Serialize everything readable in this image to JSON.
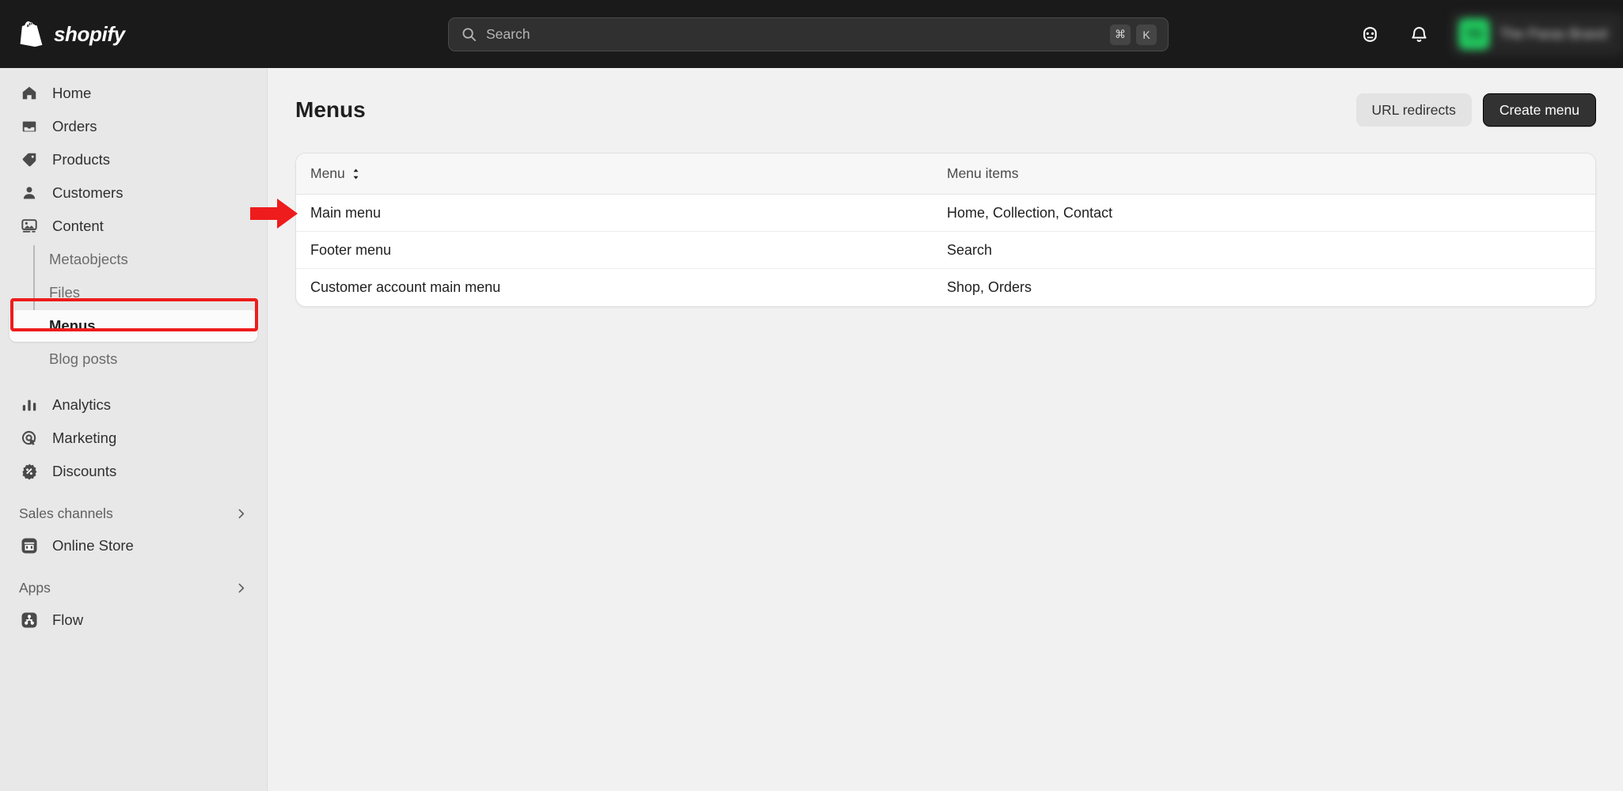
{
  "topbar": {
    "brand": "shopify",
    "logo_icon": "shopify-bag-icon",
    "search": {
      "icon": "search-icon",
      "placeholder": "Search",
      "shortcut_modifier": "⌘",
      "shortcut_key": "K"
    },
    "actions": [
      {
        "icon": "avatar-face-icon",
        "name": "support-avatar-button"
      },
      {
        "icon": "bell-icon",
        "name": "notifications-button"
      }
    ],
    "store": {
      "avatar_initials": "TR",
      "name": "The Paras Brand",
      "avatar_color": "#22c55e"
    }
  },
  "sidebar": {
    "items": [
      {
        "label": "Home",
        "icon": "home-icon"
      },
      {
        "label": "Orders",
        "icon": "orders-inbox-icon"
      },
      {
        "label": "Products",
        "icon": "products-tag-icon"
      },
      {
        "label": "Customers",
        "icon": "customers-person-icon"
      },
      {
        "label": "Content",
        "icon": "content-image-icon"
      }
    ],
    "content_children": [
      {
        "label": "Metaobjects",
        "active": false
      },
      {
        "label": "Files",
        "active": false
      },
      {
        "label": "Menus",
        "active": true
      },
      {
        "label": "Blog posts",
        "active": false
      }
    ],
    "items_lower": [
      {
        "label": "Analytics",
        "icon": "analytics-bars-icon"
      },
      {
        "label": "Marketing",
        "icon": "marketing-target-icon"
      },
      {
        "label": "Discounts",
        "icon": "discounts-badge-icon"
      }
    ],
    "sales_channels": {
      "label": "Sales channels",
      "chevron_icon": "chevron-right-icon",
      "items": [
        {
          "label": "Online Store",
          "icon": "online-store-icon"
        }
      ]
    },
    "apps": {
      "label": "Apps",
      "chevron_icon": "chevron-right-icon",
      "items": [
        {
          "label": "Flow",
          "icon": "flow-icon"
        }
      ]
    }
  },
  "main": {
    "title": "Menus",
    "buttons": {
      "url_redirects": "URL redirects",
      "create_menu": "Create menu"
    },
    "table": {
      "columns": [
        {
          "label": "Menu",
          "sortable": true,
          "sort_icon": "sort-chevrons-icon"
        },
        {
          "label": "Menu items",
          "sortable": false
        }
      ],
      "rows": [
        {
          "menu": "Main menu",
          "items": "Home, Collection, Contact"
        },
        {
          "menu": "Footer menu",
          "items": "Search"
        },
        {
          "menu": "Customer account main menu",
          "items": "Shop, Orders"
        }
      ]
    }
  },
  "annotations": {
    "highlight_color": "#ee1c1c",
    "box_target": "Menus",
    "arrow_target": "Main menu"
  }
}
